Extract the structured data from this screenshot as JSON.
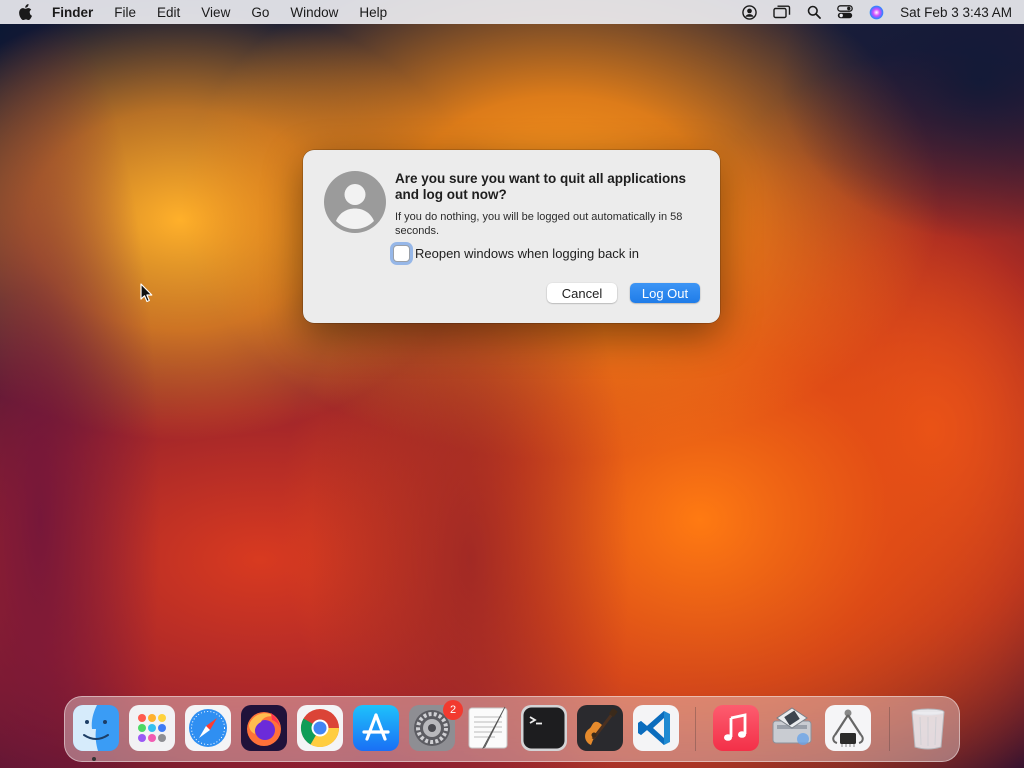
{
  "menubar": {
    "app_name": "Finder",
    "menus": [
      "File",
      "Edit",
      "View",
      "Go",
      "Window",
      "Help"
    ],
    "status_icons": [
      "user-account-icon",
      "screen-mirroring-icon",
      "spotlight-search-icon",
      "control-center-icon",
      "siri-icon"
    ],
    "clock": "Sat Feb 3  3:43 AM"
  },
  "dialog": {
    "title": "Are you sure you want to quit all applications and log out now?",
    "message": "If you do nothing, you will be logged out automatically in 58 seconds.",
    "checkbox_label": "Reopen windows when logging back in",
    "checkbox_checked": false,
    "cancel_label": "Cancel",
    "logout_label": "Log Out",
    "accent_color": "#1f7ce8"
  },
  "dock": {
    "items": [
      {
        "name": "finder",
        "icon": "finder-icon",
        "running": true
      },
      {
        "name": "launchpad",
        "icon": "launchpad-icon"
      },
      {
        "name": "safari",
        "icon": "safari-icon"
      },
      {
        "name": "firefox",
        "icon": "firefox-icon"
      },
      {
        "name": "chrome",
        "icon": "chrome-icon"
      },
      {
        "name": "app-store",
        "icon": "app-store-icon"
      },
      {
        "name": "system-preferences",
        "icon": "system-preferences-icon",
        "badge": "2"
      },
      {
        "name": "textedit",
        "icon": "textedit-icon"
      },
      {
        "name": "terminal",
        "icon": "terminal-icon"
      },
      {
        "name": "garageband",
        "icon": "garageband-icon"
      },
      {
        "name": "vscode",
        "icon": "vscode-icon"
      },
      {
        "name": "music",
        "icon": "music-icon"
      },
      {
        "name": "boot-camp-assistant",
        "icon": "boot-camp-icon"
      },
      {
        "name": "system-information",
        "icon": "system-information-icon"
      },
      {
        "name": "trash",
        "icon": "trash-icon"
      }
    ]
  }
}
